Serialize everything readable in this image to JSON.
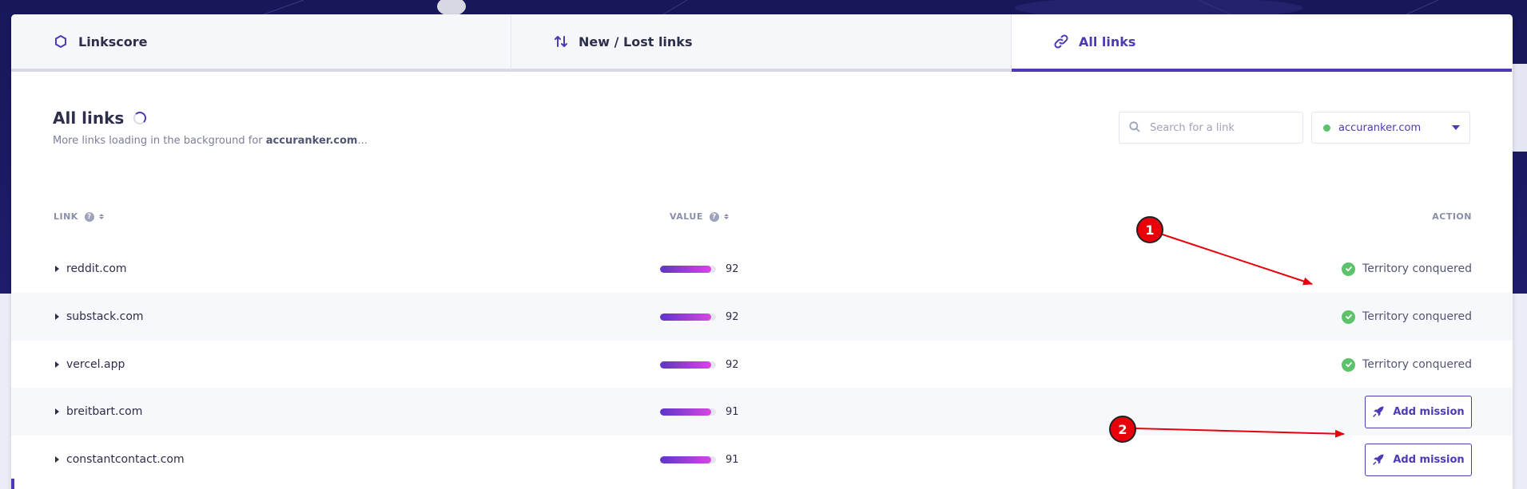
{
  "tabs": [
    {
      "label": "Linkscore",
      "icon": "hexagon-icon",
      "active": false
    },
    {
      "label": "New / Lost links",
      "icon": "sort-arrows-icon",
      "active": false
    },
    {
      "label": "All links",
      "icon": "link-icon",
      "active": true
    }
  ],
  "header": {
    "title": "All links",
    "subtitle_prefix": "More links loading in the background for ",
    "subtitle_domain": "accuranker.com",
    "subtitle_suffix": "..."
  },
  "search": {
    "placeholder": "Search for a link",
    "value": ""
  },
  "domain_select": {
    "value": "accuranker.com",
    "status_color": "#5cc36b"
  },
  "table": {
    "columns": {
      "link": "LINK",
      "value": "VALUE",
      "action": "ACTION"
    },
    "rows": [
      {
        "domain": "reddit.com",
        "value": "92",
        "score_percent": 92,
        "action_type": "conquered",
        "action_label": "Territory conquered"
      },
      {
        "domain": "substack.com",
        "value": "92",
        "score_percent": 92,
        "action_type": "conquered",
        "action_label": "Territory conquered"
      },
      {
        "domain": "vercel.app",
        "value": "92",
        "score_percent": 92,
        "action_type": "conquered",
        "action_label": "Territory conquered"
      },
      {
        "domain": "breitbart.com",
        "value": "91",
        "score_percent": 91,
        "action_type": "mission",
        "action_label": "Add mission"
      },
      {
        "domain": "constantcontact.com",
        "value": "91",
        "score_percent": 91,
        "action_type": "mission",
        "action_label": "Add mission"
      }
    ]
  },
  "annotations": [
    {
      "number": "1"
    },
    {
      "number": "2"
    }
  ],
  "colors": {
    "accent": "#4b3bb5",
    "success": "#5cc36b",
    "bar_start": "#5d35c9",
    "bar_end": "#d647e0",
    "annotation_red": "#e8000b"
  }
}
